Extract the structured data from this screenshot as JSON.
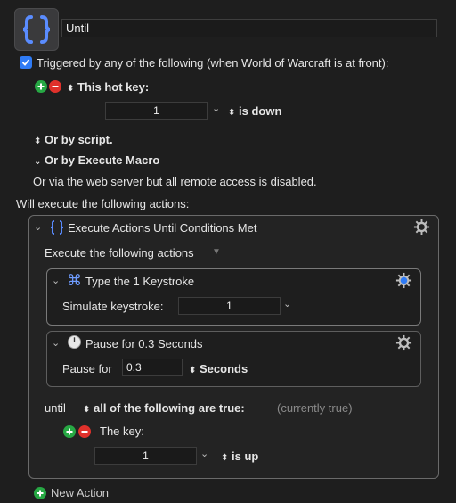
{
  "macro": {
    "title_value": "Until"
  },
  "trigger": {
    "enabled_label": "Triggered by any of the following (when World of Warcraft is at front):",
    "hotkey": {
      "label": "This hot key:",
      "key_value": "1",
      "state": "is down"
    },
    "or_script": "Or by script.",
    "or_execute_macro": "Or by Execute Macro",
    "web_server": "Or via the web server but all remote access is disabled."
  },
  "actions_heading": "Will execute the following actions:",
  "until_action": {
    "title": "Execute Actions Until Conditions Met",
    "execute_label": "Execute the following actions",
    "type_action": {
      "title": "Type the 1 Keystroke",
      "simulate_label": "Simulate keystroke:",
      "keystroke_value": "1"
    },
    "pause_action": {
      "title": "Pause for 0.3 Seconds",
      "pause_label": "Pause for",
      "pause_value": "0.3",
      "unit": "Seconds"
    },
    "until_label": "until",
    "condition_mode": "all of the following are true:",
    "condition_status": "(currently true)",
    "key_condition": {
      "label": "The key:",
      "key_value": "1",
      "state": "is up"
    }
  },
  "new_action": "New Action",
  "colors": {
    "accent": "#2f7bf5",
    "plus": "#27a844",
    "minus": "#e0312b",
    "gear_active": "#2f7bf5"
  }
}
